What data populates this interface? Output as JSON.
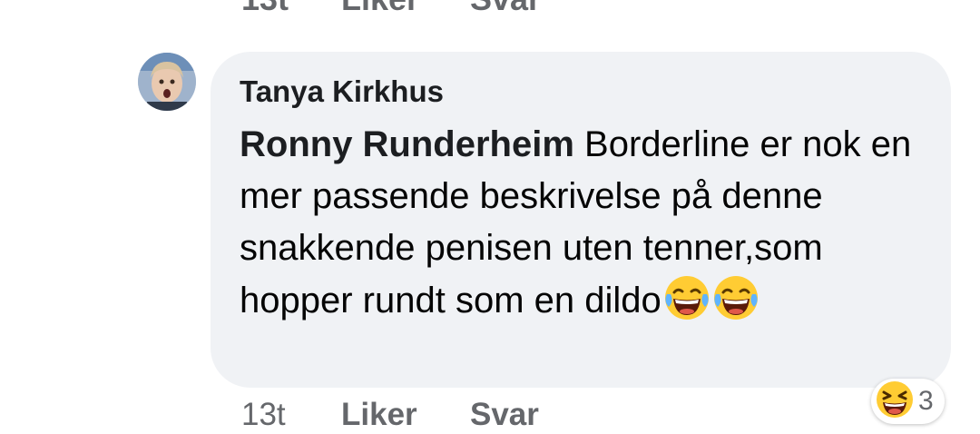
{
  "previous_comment_actions": {
    "time": "13t",
    "like": "Liker",
    "reply": "Svar"
  },
  "comment": {
    "author": "Tanya Kirkhus",
    "mention": "Ronny Runderheim",
    "text": " Borderline er nok en mer passende beskrivelse på denne snakkende penisen uten tenner,som hopper rundt som en dildo",
    "trailing_emojis": [
      "laughing-tears-emoji",
      "laughing-tears-emoji"
    ]
  },
  "actions": {
    "time": "13t",
    "like": "Liker",
    "reply": "Svar"
  },
  "reactions": {
    "icon": "laughing-squint-emoji",
    "count": "3"
  },
  "colors": {
    "bubble": "#f0f2f5",
    "text": "#050505",
    "meta": "#65676b",
    "emoji_yellow": "#ffcc33"
  }
}
